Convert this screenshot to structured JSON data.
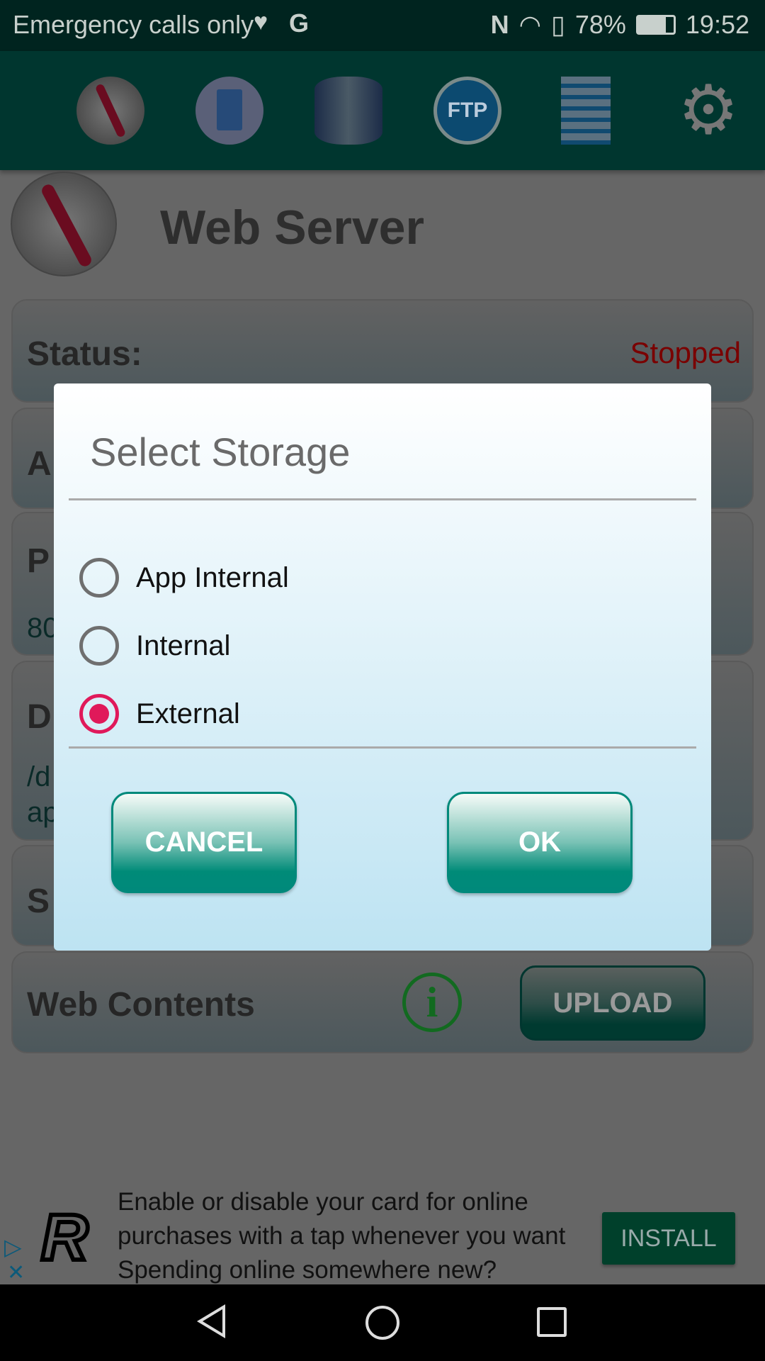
{
  "status_bar": {
    "carrier": "Emergency calls only",
    "battery": "78%",
    "time": "19:52"
  },
  "toolbar": {
    "icons": [
      "apache-feather-icon",
      "log-document-icon",
      "mysql-database-icon",
      "ftp-cloud-icon",
      "text-document-icon",
      "gear-icon"
    ]
  },
  "header": {
    "title": "Web Server"
  },
  "cards": {
    "status_label": "Status:",
    "status_value": "Stopped",
    "card2_fragment": "A",
    "card3_fragment": "P",
    "card3_value_fragment": "80",
    "card4_fragment": "D",
    "card4_value_line1": "/d",
    "card4_value_line2": "ap",
    "card5_fragment": "S",
    "web_contents_label": "Web Contents",
    "upload_label": "UPLOAD"
  },
  "dialog": {
    "title": "Select Storage",
    "options": [
      {
        "label": "App Internal",
        "selected": false
      },
      {
        "label": "Internal",
        "selected": false
      },
      {
        "label": "External",
        "selected": true
      }
    ],
    "cancel_label": "CANCEL",
    "ok_label": "OK"
  },
  "ad": {
    "text_line1": "Enable or disable your card for online",
    "text_line2": "purchases with a tap whenever you want",
    "text_line3": "Spending online somewhere new?",
    "install_label": "INSTALL",
    "logo": "R"
  },
  "colors": {
    "accent": "#00897b",
    "radio_selected": "#e0195a",
    "status_stopped": "#c00000"
  }
}
